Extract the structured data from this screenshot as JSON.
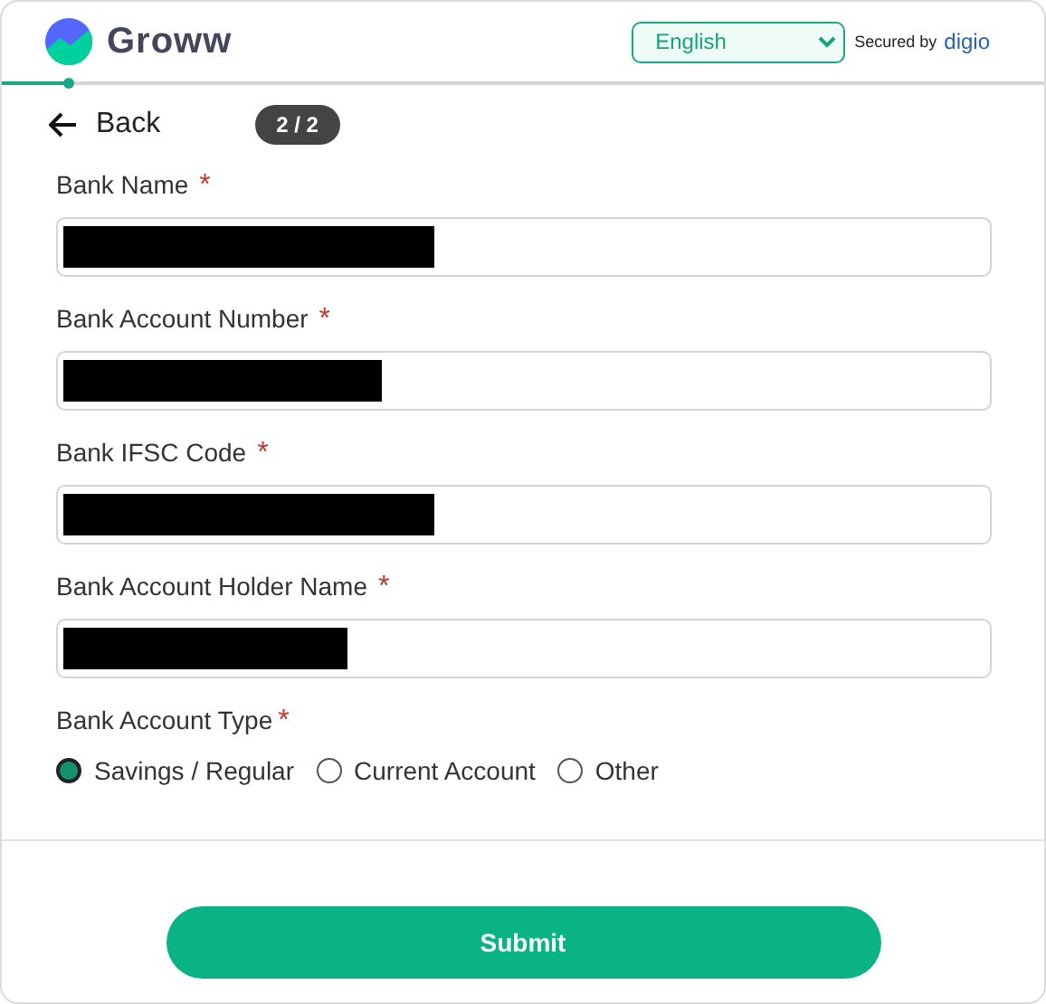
{
  "header": {
    "brand": "Groww",
    "language": {
      "value": "English"
    },
    "secured_by": "Secured by",
    "provider": "digio"
  },
  "progress": {
    "level": 0.065
  },
  "nav": {
    "back": "Back",
    "step": "2 / 2"
  },
  "fields": [
    {
      "label": "Bank Name",
      "required_mark": "*",
      "redacted": true
    },
    {
      "label": "Bank Account Number",
      "required_mark": "*",
      "redacted": true
    },
    {
      "label": "Bank IFSC Code",
      "required_mark": "*",
      "redacted": true
    },
    {
      "label": "Bank Account Holder Name",
      "required_mark": "*",
      "redacted": true
    }
  ],
  "account_type": {
    "label": "Bank Account Type",
    "required_mark": "*",
    "options": [
      {
        "label": "Savings / Regular",
        "selected": true
      },
      {
        "label": "Current Account",
        "selected": false
      },
      {
        "label": "Other",
        "selected": false
      }
    ]
  },
  "submit": "Submit"
}
